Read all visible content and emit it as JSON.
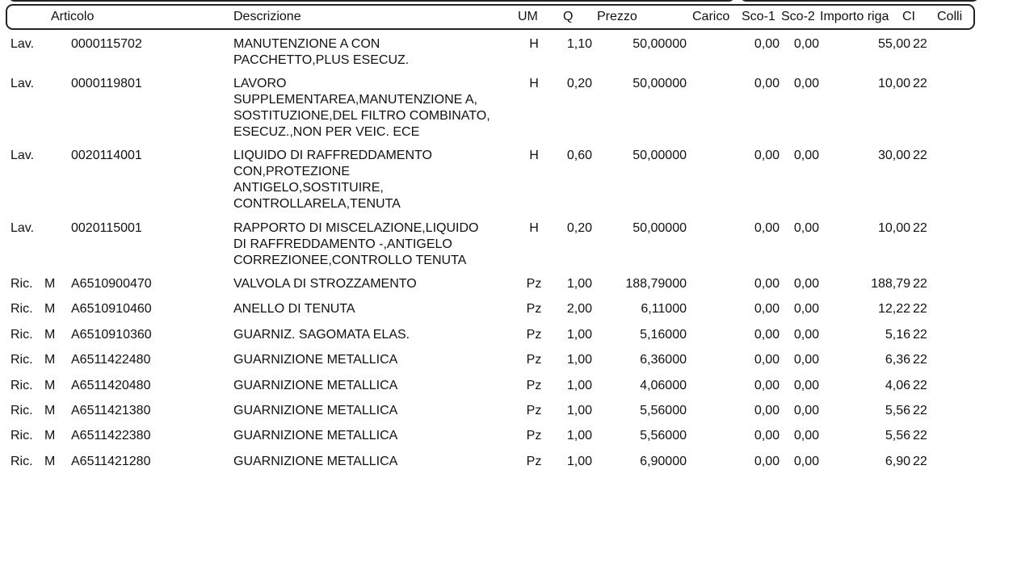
{
  "headers": {
    "articolo": "Articolo",
    "descrizione": "Descrizione",
    "um": "UM",
    "q": "Q",
    "prezzo": "Prezzo",
    "carico": "Carico",
    "sco1": "Sco-1",
    "sco2": "Sco-2",
    "importo": "Importo riga",
    "ci": "CI",
    "colli": "Colli"
  },
  "rows": [
    {
      "tipo": "Lav.",
      "flag": "",
      "articolo": "0000115702",
      "descrizione": "MANUTENZIONE A CON\nPACCHETTO,PLUS ESECUZ.",
      "um": "H",
      "q": "1,10",
      "prezzo": "50,00000",
      "sco1": "0,00",
      "sco2": "0,00",
      "importo": "55,00",
      "ci": "22"
    },
    {
      "tipo": "Lav.",
      "flag": "",
      "articolo": "0000119801",
      "descrizione": "LAVORO\nSUPPLEMENTAREA,MANUTENZIONE A,\nSOSTITUZIONE,DEL FILTRO COMBINATO,\nESECUZ.,NON PER VEIC. ECE",
      "um": "H",
      "q": "0,20",
      "prezzo": "50,00000",
      "sco1": "0,00",
      "sco2": "0,00",
      "importo": "10,00",
      "ci": "22"
    },
    {
      "tipo": "Lav.",
      "flag": "",
      "articolo": "0020114001",
      "descrizione": "LIQUIDO DI RAFFREDDAMENTO\nCON,PROTEZIONE\nANTIGELO,SOSTITUIRE,\nCONTROLLARELA,TENUTA",
      "um": "H",
      "q": "0,60",
      "prezzo": "50,00000",
      "sco1": "0,00",
      "sco2": "0,00",
      "importo": "30,00",
      "ci": "22"
    },
    {
      "tipo": "Lav.",
      "flag": "",
      "articolo": "0020115001",
      "descrizione": "RAPPORTO DI MISCELAZIONE,LIQUIDO\nDI RAFFREDDAMENTO -,ANTIGELO\nCORREZIONEE,CONTROLLO TENUTA",
      "um": "H",
      "q": "0,20",
      "prezzo": "50,00000",
      "sco1": "0,00",
      "sco2": "0,00",
      "importo": "10,00",
      "ci": "22"
    },
    {
      "tipo": "Ric.",
      "flag": "M",
      "articolo": "A6510900470",
      "descrizione": "VALVOLA DI STROZZAMENTO",
      "um": "Pz",
      "q": "1,00",
      "prezzo": "188,79000",
      "sco1": "0,00",
      "sco2": "0,00",
      "importo": "188,79",
      "ci": "22"
    },
    {
      "tipo": "Ric.",
      "flag": "M",
      "articolo": "A6510910460",
      "descrizione": "ANELLO DI TENUTA",
      "um": "Pz",
      "q": "2,00",
      "prezzo": "6,11000",
      "sco1": "0,00",
      "sco2": "0,00",
      "importo": "12,22",
      "ci": "22"
    },
    {
      "tipo": "Ric.",
      "flag": "M",
      "articolo": "A6510910360",
      "descrizione": "GUARNIZ. SAGOMATA ELAS.",
      "um": "Pz",
      "q": "1,00",
      "prezzo": "5,16000",
      "sco1": "0,00",
      "sco2": "0,00",
      "importo": "5,16",
      "ci": "22"
    },
    {
      "tipo": "Ric.",
      "flag": "M",
      "articolo": "A6511422480",
      "descrizione": "GUARNIZIONE METALLICA",
      "um": "Pz",
      "q": "1,00",
      "prezzo": "6,36000",
      "sco1": "0,00",
      "sco2": "0,00",
      "importo": "6,36",
      "ci": "22"
    },
    {
      "tipo": "Ric.",
      "flag": "M",
      "articolo": "A6511420480",
      "descrizione": "GUARNIZIONE METALLICA",
      "um": "Pz",
      "q": "1,00",
      "prezzo": "4,06000",
      "sco1": "0,00",
      "sco2": "0,00",
      "importo": "4,06",
      "ci": "22"
    },
    {
      "tipo": "Ric.",
      "flag": "M",
      "articolo": "A6511421380",
      "descrizione": "GUARNIZIONE METALLICA",
      "um": "Pz",
      "q": "1,00",
      "prezzo": "5,56000",
      "sco1": "0,00",
      "sco2": "0,00",
      "importo": "5,56",
      "ci": "22"
    },
    {
      "tipo": "Ric.",
      "flag": "M",
      "articolo": "A6511422380",
      "descrizione": "GUARNIZIONE METALLICA",
      "um": "Pz",
      "q": "1,00",
      "prezzo": "5,56000",
      "sco1": "0,00",
      "sco2": "0,00",
      "importo": "5,56",
      "ci": "22"
    },
    {
      "tipo": "Ric.",
      "flag": "M",
      "articolo": "A6511421280",
      "descrizione": "GUARNIZIONE METALLICA",
      "um": "Pz",
      "q": "1,00",
      "prezzo": "6,90000",
      "sco1": "0,00",
      "sco2": "0,00",
      "importo": "6,90",
      "ci": "22"
    }
  ]
}
